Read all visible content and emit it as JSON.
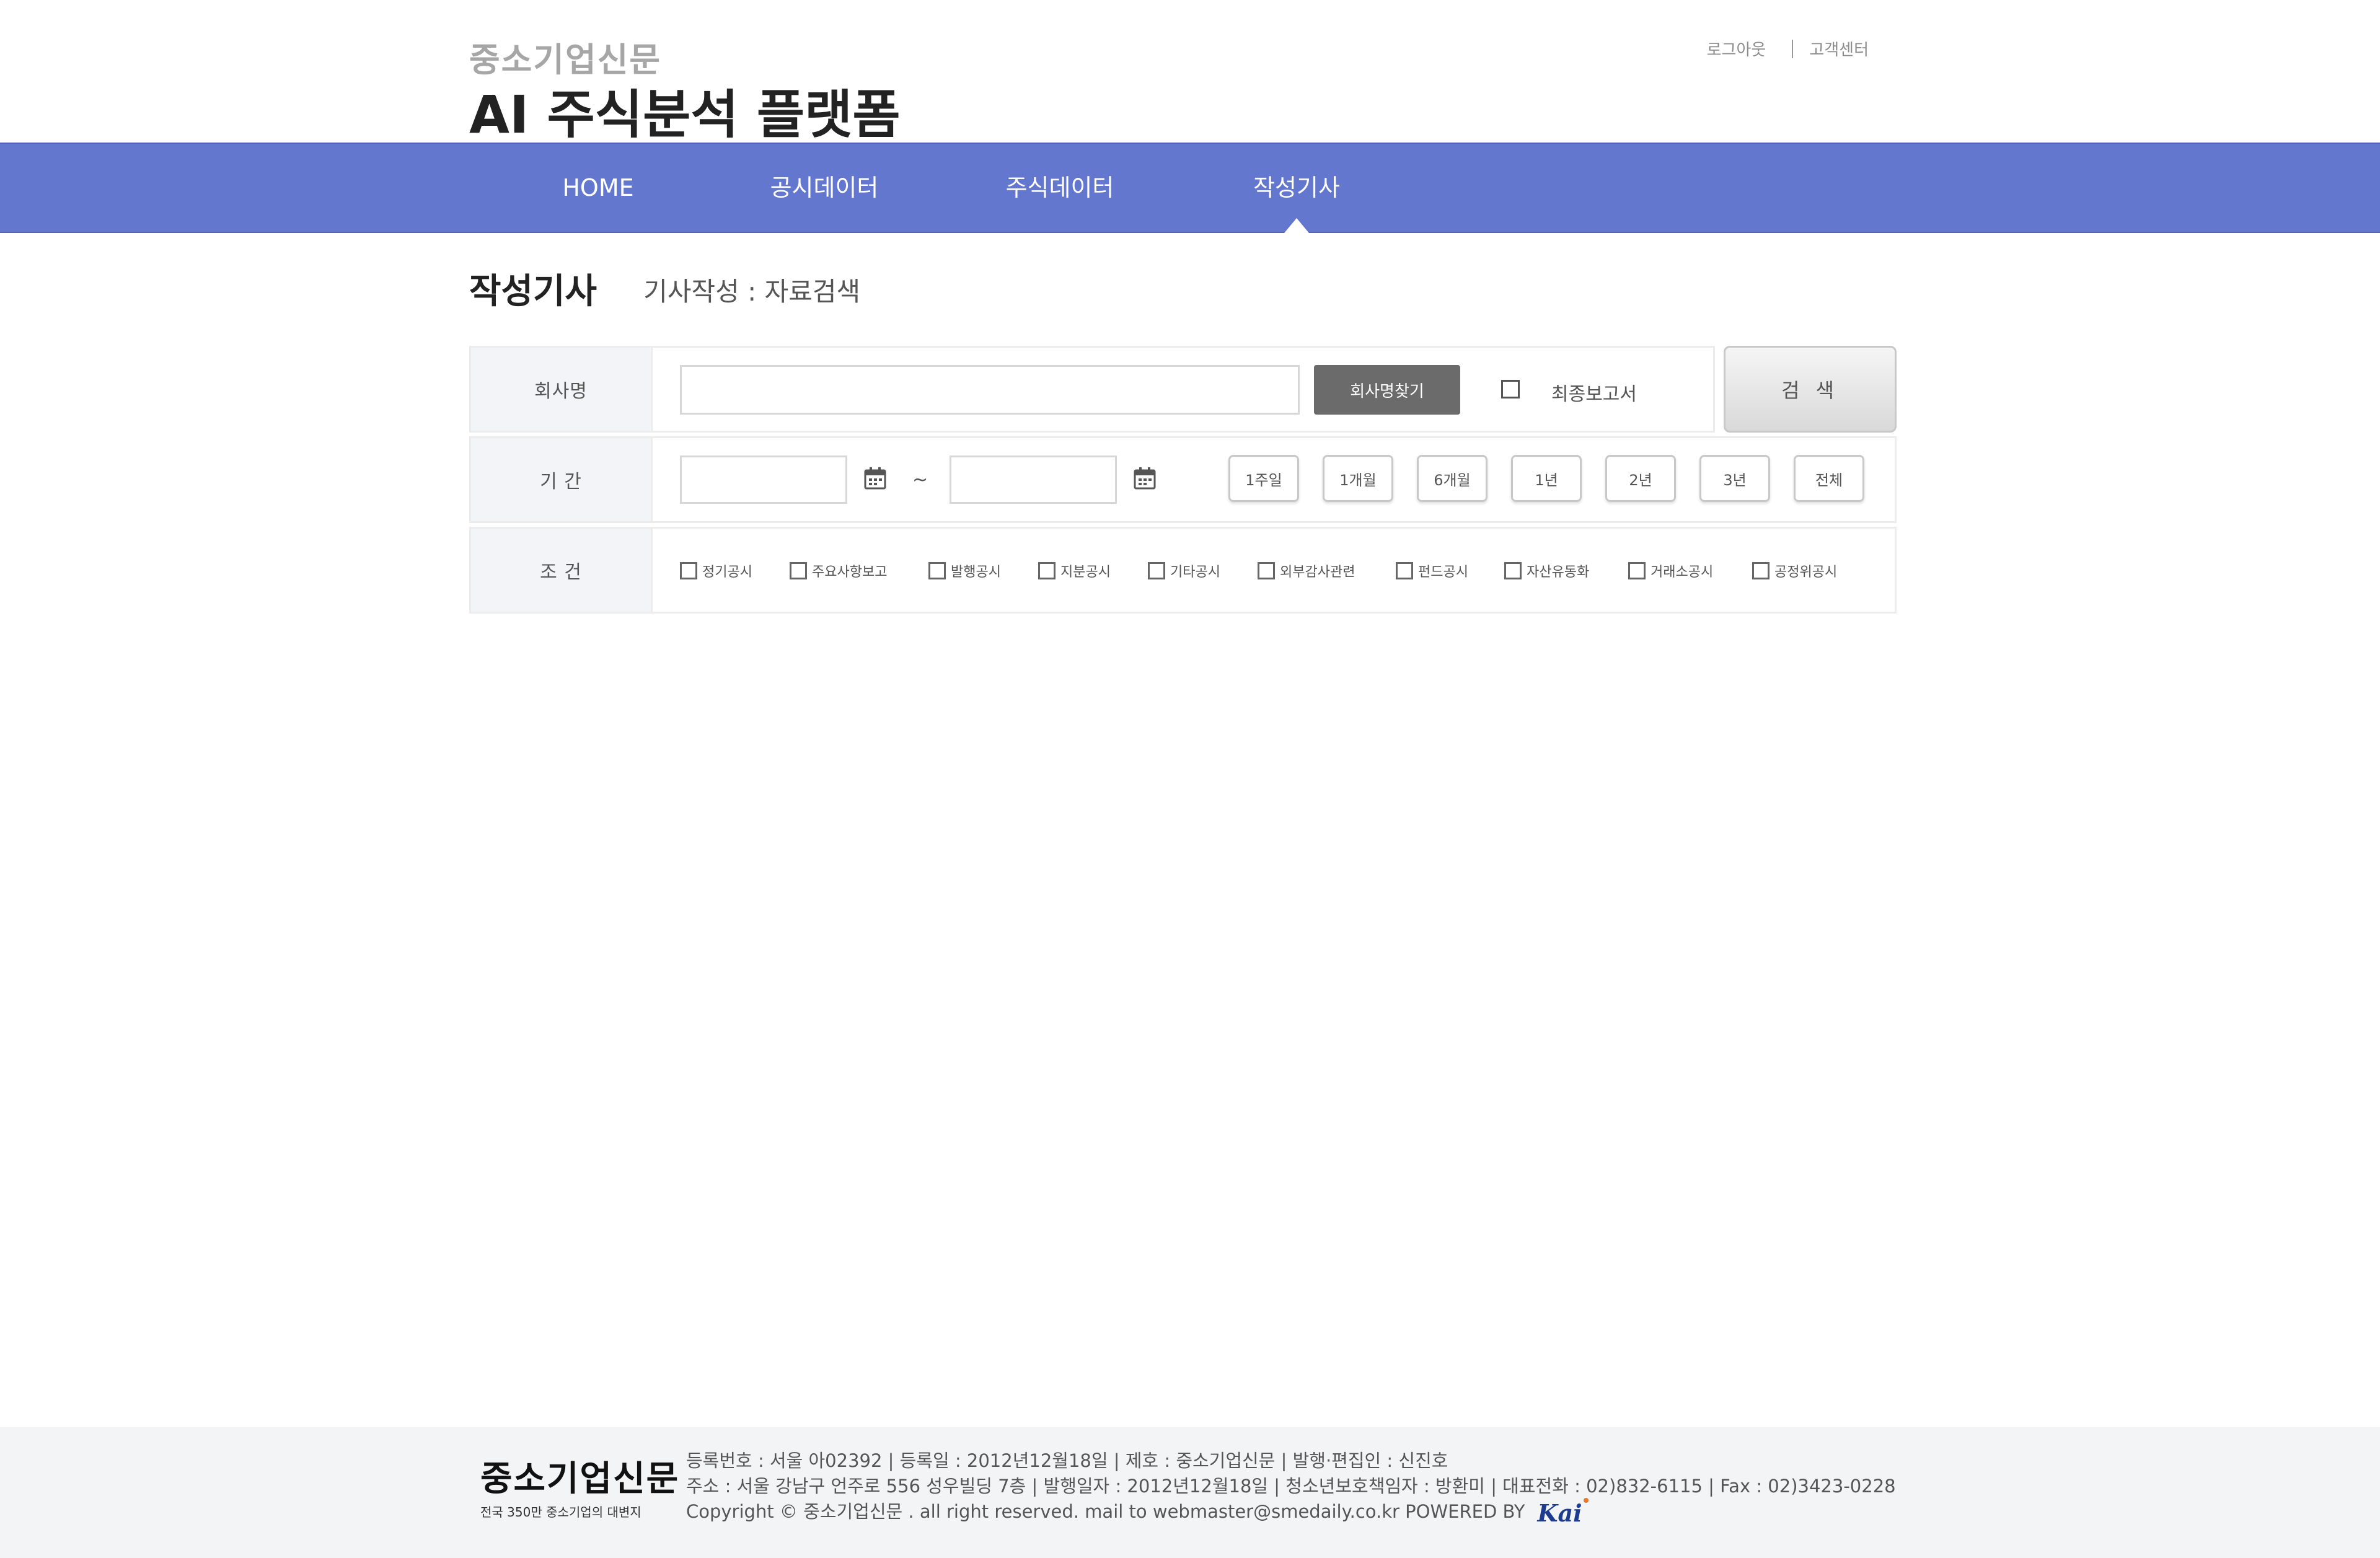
{
  "header": {
    "brand": "중소기업신문",
    "platform_title": "AI 주식분석 플랫폼",
    "util_links": [
      "로그아웃",
      "고객센터"
    ]
  },
  "nav": {
    "items": [
      "HOME",
      "공시데이터",
      "주식데이터",
      "작성기사"
    ],
    "active_index": 3,
    "color": "#6477cf"
  },
  "page": {
    "title": "작성기사",
    "subtitle": "기사작성 : 자료검색"
  },
  "search": {
    "company_label": "회사명",
    "company_value": "",
    "company_placeholder": "",
    "find_button": "회사명찾기",
    "final_report_label": "최종보고서",
    "final_report_checked": false,
    "search_button": "검 색",
    "period_label": "기  간",
    "date_from": "",
    "date_to": "",
    "tilde": "~",
    "period_buttons": [
      "1주일",
      "1개월",
      "6개월",
      "1년",
      "2년",
      "3년",
      "전체"
    ],
    "condition_label": "조  건",
    "conditions": [
      "정기공시",
      "주요사항보고",
      "발행공시",
      "지분공시",
      "기타공시",
      "외부감사관련",
      "펀드공시",
      "자산유동화",
      "거래소공시",
      "공정위공시"
    ]
  },
  "footer": {
    "logo_name": "중소기업신문",
    "logo_tag": "전국 350만 중소기업의 대변지",
    "line1": "등록번호 : 서울 아02392 | 등록일 : 2012년12월18일 | 제호 : 중소기업신문 | 발행·편집인 : 신진호",
    "line2": "주소 : 서울 강남구 언주로 556 성우빌딩 7층 | 발행일자 : 2012년12월18일 | 청소년보호책임자 : 방환미 | 대표전화 : 02)832-6115 | Fax : 02)3423-0228",
    "line3": "Copyright © 중소기업신문 . all right reserved. mail to webmaster@smedaily.co.kr  POWERED BY",
    "powered_logo": "Kai"
  }
}
